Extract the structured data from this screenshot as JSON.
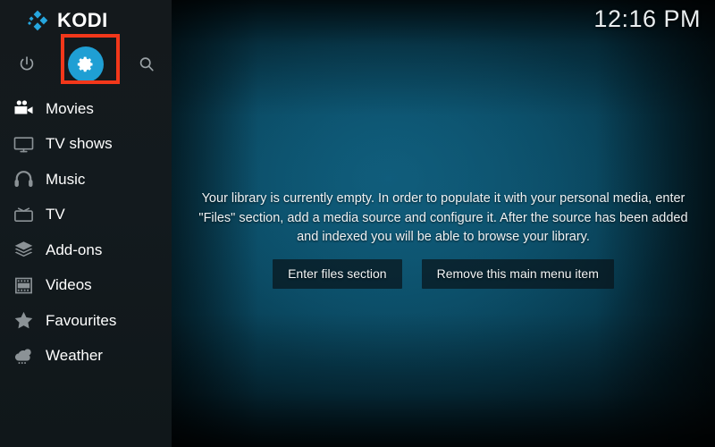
{
  "brand": {
    "name": "KODI",
    "logo_icon": "kodi-logo-icon"
  },
  "clock": {
    "time": "12:16 PM"
  },
  "colors": {
    "accent_blue": "#1f9fd4",
    "highlight_red": "#f2371a",
    "sidebar_bg": "#131a1e",
    "background_teal": "#0a4a63",
    "text_primary": "#ffffff",
    "icon_muted": "#8b9296"
  },
  "top_icons": [
    {
      "name": "power",
      "icon": "power-icon",
      "label": "Power"
    },
    {
      "name": "settings",
      "icon": "gear-icon",
      "label": "Settings",
      "selected": true,
      "highlighted": true
    },
    {
      "name": "search",
      "icon": "search-icon",
      "label": "Search"
    }
  ],
  "sidebar": {
    "items": [
      {
        "label": "Movies",
        "icon": "movie-camera-icon",
        "active": true
      },
      {
        "label": "TV shows",
        "icon": "tv-monitor-icon",
        "active": false
      },
      {
        "label": "Music",
        "icon": "headphones-icon",
        "active": false
      },
      {
        "label": "TV",
        "icon": "retro-tv-icon",
        "active": false
      },
      {
        "label": "Add-ons",
        "icon": "addons-box-icon",
        "active": false
      },
      {
        "label": "Videos",
        "icon": "film-strip-icon",
        "active": false
      },
      {
        "label": "Favourites",
        "icon": "star-icon",
        "active": false
      },
      {
        "label": "Weather",
        "icon": "weather-cloud-icon",
        "active": false
      }
    ]
  },
  "main": {
    "empty_message": "Your library is currently empty. In order to populate it with your personal media, enter \"Files\" section, add a media source and configure it. After the source has been added and indexed you will be able to browse your library.",
    "buttons": [
      {
        "label": "Enter files section"
      },
      {
        "label": "Remove this main menu item"
      }
    ]
  }
}
